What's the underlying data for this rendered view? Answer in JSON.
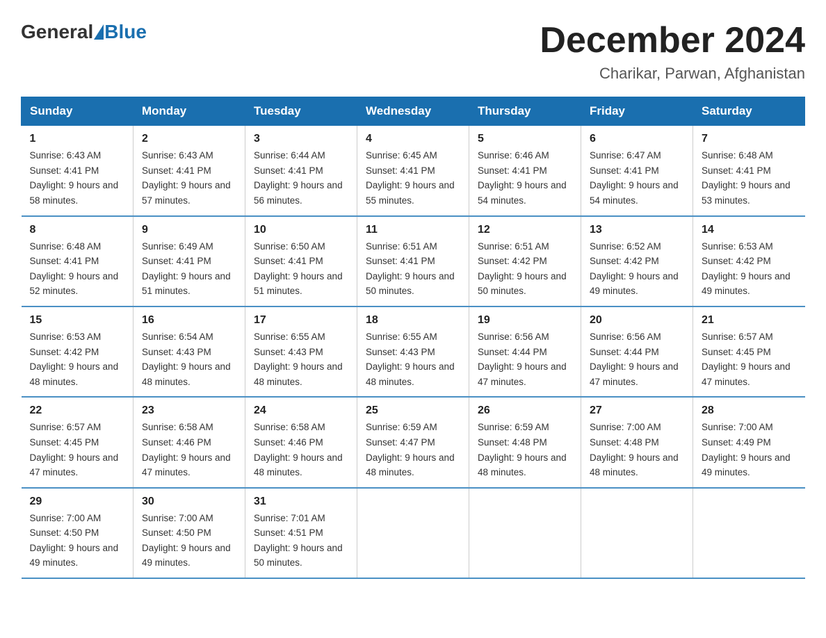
{
  "header": {
    "logo_general": "General",
    "logo_blue": "Blue",
    "month_year": "December 2024",
    "location": "Charikar, Parwan, Afghanistan"
  },
  "days_of_week": [
    "Sunday",
    "Monday",
    "Tuesday",
    "Wednesday",
    "Thursday",
    "Friday",
    "Saturday"
  ],
  "weeks": [
    [
      {
        "day": "1",
        "sunrise": "6:43 AM",
        "sunset": "4:41 PM",
        "daylight": "9 hours and 58 minutes."
      },
      {
        "day": "2",
        "sunrise": "6:43 AM",
        "sunset": "4:41 PM",
        "daylight": "9 hours and 57 minutes."
      },
      {
        "day": "3",
        "sunrise": "6:44 AM",
        "sunset": "4:41 PM",
        "daylight": "9 hours and 56 minutes."
      },
      {
        "day": "4",
        "sunrise": "6:45 AM",
        "sunset": "4:41 PM",
        "daylight": "9 hours and 55 minutes."
      },
      {
        "day": "5",
        "sunrise": "6:46 AM",
        "sunset": "4:41 PM",
        "daylight": "9 hours and 54 minutes."
      },
      {
        "day": "6",
        "sunrise": "6:47 AM",
        "sunset": "4:41 PM",
        "daylight": "9 hours and 54 minutes."
      },
      {
        "day": "7",
        "sunrise": "6:48 AM",
        "sunset": "4:41 PM",
        "daylight": "9 hours and 53 minutes."
      }
    ],
    [
      {
        "day": "8",
        "sunrise": "6:48 AM",
        "sunset": "4:41 PM",
        "daylight": "9 hours and 52 minutes."
      },
      {
        "day": "9",
        "sunrise": "6:49 AM",
        "sunset": "4:41 PM",
        "daylight": "9 hours and 51 minutes."
      },
      {
        "day": "10",
        "sunrise": "6:50 AM",
        "sunset": "4:41 PM",
        "daylight": "9 hours and 51 minutes."
      },
      {
        "day": "11",
        "sunrise": "6:51 AM",
        "sunset": "4:41 PM",
        "daylight": "9 hours and 50 minutes."
      },
      {
        "day": "12",
        "sunrise": "6:51 AM",
        "sunset": "4:42 PM",
        "daylight": "9 hours and 50 minutes."
      },
      {
        "day": "13",
        "sunrise": "6:52 AM",
        "sunset": "4:42 PM",
        "daylight": "9 hours and 49 minutes."
      },
      {
        "day": "14",
        "sunrise": "6:53 AM",
        "sunset": "4:42 PM",
        "daylight": "9 hours and 49 minutes."
      }
    ],
    [
      {
        "day": "15",
        "sunrise": "6:53 AM",
        "sunset": "4:42 PM",
        "daylight": "9 hours and 48 minutes."
      },
      {
        "day": "16",
        "sunrise": "6:54 AM",
        "sunset": "4:43 PM",
        "daylight": "9 hours and 48 minutes."
      },
      {
        "day": "17",
        "sunrise": "6:55 AM",
        "sunset": "4:43 PM",
        "daylight": "9 hours and 48 minutes."
      },
      {
        "day": "18",
        "sunrise": "6:55 AM",
        "sunset": "4:43 PM",
        "daylight": "9 hours and 48 minutes."
      },
      {
        "day": "19",
        "sunrise": "6:56 AM",
        "sunset": "4:44 PM",
        "daylight": "9 hours and 47 minutes."
      },
      {
        "day": "20",
        "sunrise": "6:56 AM",
        "sunset": "4:44 PM",
        "daylight": "9 hours and 47 minutes."
      },
      {
        "day": "21",
        "sunrise": "6:57 AM",
        "sunset": "4:45 PM",
        "daylight": "9 hours and 47 minutes."
      }
    ],
    [
      {
        "day": "22",
        "sunrise": "6:57 AM",
        "sunset": "4:45 PM",
        "daylight": "9 hours and 47 minutes."
      },
      {
        "day": "23",
        "sunrise": "6:58 AM",
        "sunset": "4:46 PM",
        "daylight": "9 hours and 47 minutes."
      },
      {
        "day": "24",
        "sunrise": "6:58 AM",
        "sunset": "4:46 PM",
        "daylight": "9 hours and 48 minutes."
      },
      {
        "day": "25",
        "sunrise": "6:59 AM",
        "sunset": "4:47 PM",
        "daylight": "9 hours and 48 minutes."
      },
      {
        "day": "26",
        "sunrise": "6:59 AM",
        "sunset": "4:48 PM",
        "daylight": "9 hours and 48 minutes."
      },
      {
        "day": "27",
        "sunrise": "7:00 AM",
        "sunset": "4:48 PM",
        "daylight": "9 hours and 48 minutes."
      },
      {
        "day": "28",
        "sunrise": "7:00 AM",
        "sunset": "4:49 PM",
        "daylight": "9 hours and 49 minutes."
      }
    ],
    [
      {
        "day": "29",
        "sunrise": "7:00 AM",
        "sunset": "4:50 PM",
        "daylight": "9 hours and 49 minutes."
      },
      {
        "day": "30",
        "sunrise": "7:00 AM",
        "sunset": "4:50 PM",
        "daylight": "9 hours and 49 minutes."
      },
      {
        "day": "31",
        "sunrise": "7:01 AM",
        "sunset": "4:51 PM",
        "daylight": "9 hours and 50 minutes."
      },
      {
        "day": "",
        "sunrise": "",
        "sunset": "",
        "daylight": ""
      },
      {
        "day": "",
        "sunrise": "",
        "sunset": "",
        "daylight": ""
      },
      {
        "day": "",
        "sunrise": "",
        "sunset": "",
        "daylight": ""
      },
      {
        "day": "",
        "sunrise": "",
        "sunset": "",
        "daylight": ""
      }
    ]
  ]
}
